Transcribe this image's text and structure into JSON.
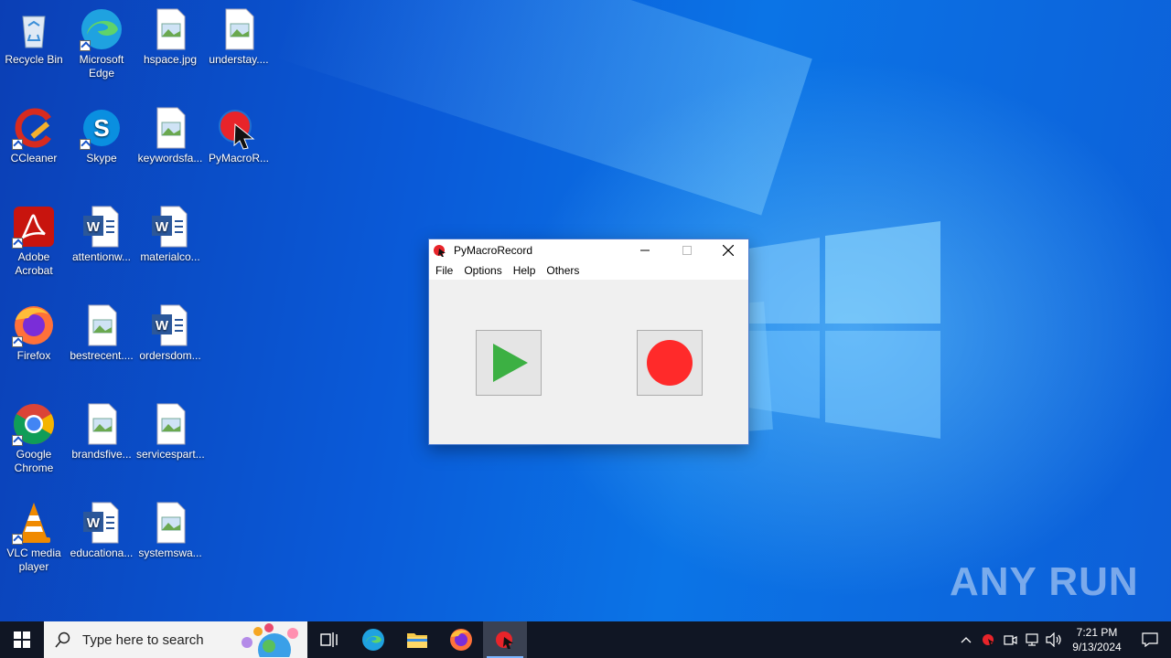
{
  "desktop": {
    "icons": [
      {
        "label": "Recycle Bin",
        "icon": "recycle-bin-icon"
      },
      {
        "label": "Microsoft Edge",
        "icon": "edge-icon"
      },
      {
        "label": "hspace.jpg",
        "icon": "image-file-icon"
      },
      {
        "label": "understay....",
        "icon": "image-file-icon"
      },
      {
        "label": "CCleaner",
        "icon": "ccleaner-icon"
      },
      {
        "label": "Skype",
        "icon": "skype-icon"
      },
      {
        "label": "keywordsfa...",
        "icon": "image-file-icon"
      },
      {
        "label": "PyMacroR...",
        "icon": "pymacrorecord-icon"
      },
      {
        "label": "Adobe Acrobat",
        "icon": "acrobat-icon"
      },
      {
        "label": "attentionw...",
        "icon": "word-doc-icon"
      },
      {
        "label": "materialco...",
        "icon": "word-doc-icon"
      },
      {
        "label": "Firefox",
        "icon": "firefox-icon"
      },
      {
        "label": "bestrecent....",
        "icon": "image-file-icon"
      },
      {
        "label": "ordersdom...",
        "icon": "word-doc-icon"
      },
      {
        "label": "Google Chrome",
        "icon": "chrome-icon"
      },
      {
        "label": "brandsfive...",
        "icon": "image-file-icon"
      },
      {
        "label": "servicespart...",
        "icon": "image-file-icon"
      },
      {
        "label": "VLC media player",
        "icon": "vlc-icon"
      },
      {
        "label": "educationa...",
        "icon": "word-doc-icon"
      },
      {
        "label": "systemswa...",
        "icon": "image-file-icon"
      }
    ]
  },
  "window": {
    "title": "PyMacroRecord",
    "menu": [
      "File",
      "Options",
      "Help",
      "Others"
    ],
    "play_icon": "play-icon",
    "record_icon": "record-icon",
    "colors": {
      "play": "#3cb043",
      "record": "#ff2a2a"
    }
  },
  "watermark": "ANY RUN",
  "taskbar": {
    "search_placeholder": "Type here to search",
    "time": "7:21 PM",
    "date": "9/13/2024"
  }
}
